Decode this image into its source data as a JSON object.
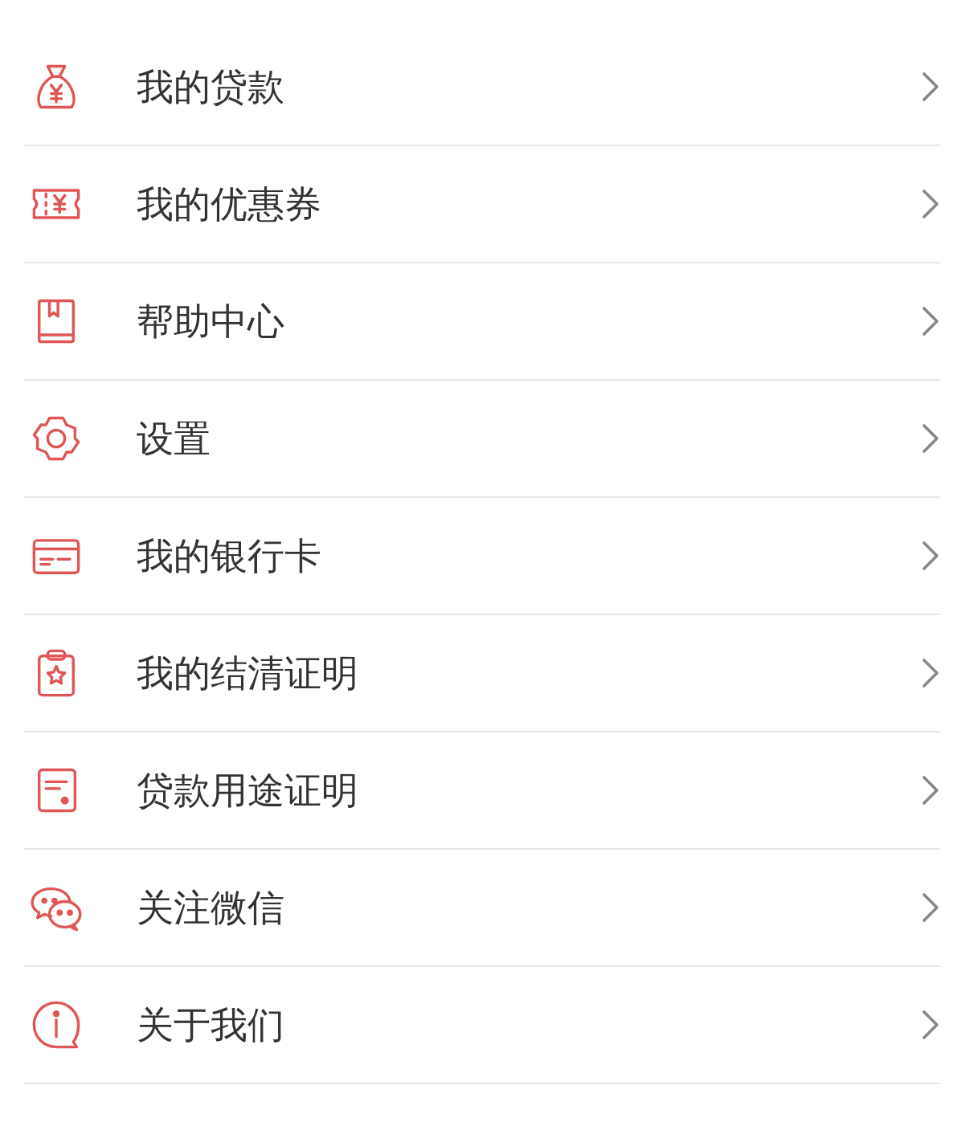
{
  "menu": [
    {
      "kind": "loan",
      "label": "我的贷款"
    },
    {
      "kind": "coupon",
      "label": "我的优惠券"
    },
    {
      "kind": "help",
      "label": "帮助中心"
    },
    {
      "kind": "settings",
      "label": "设置"
    },
    {
      "kind": "card",
      "label": "我的银行卡"
    },
    {
      "kind": "certificate",
      "label": "我的结清证明"
    },
    {
      "kind": "document",
      "label": "贷款用途证明"
    },
    {
      "kind": "wechat",
      "label": "关注微信"
    },
    {
      "kind": "about",
      "label": "关于我们"
    }
  ]
}
